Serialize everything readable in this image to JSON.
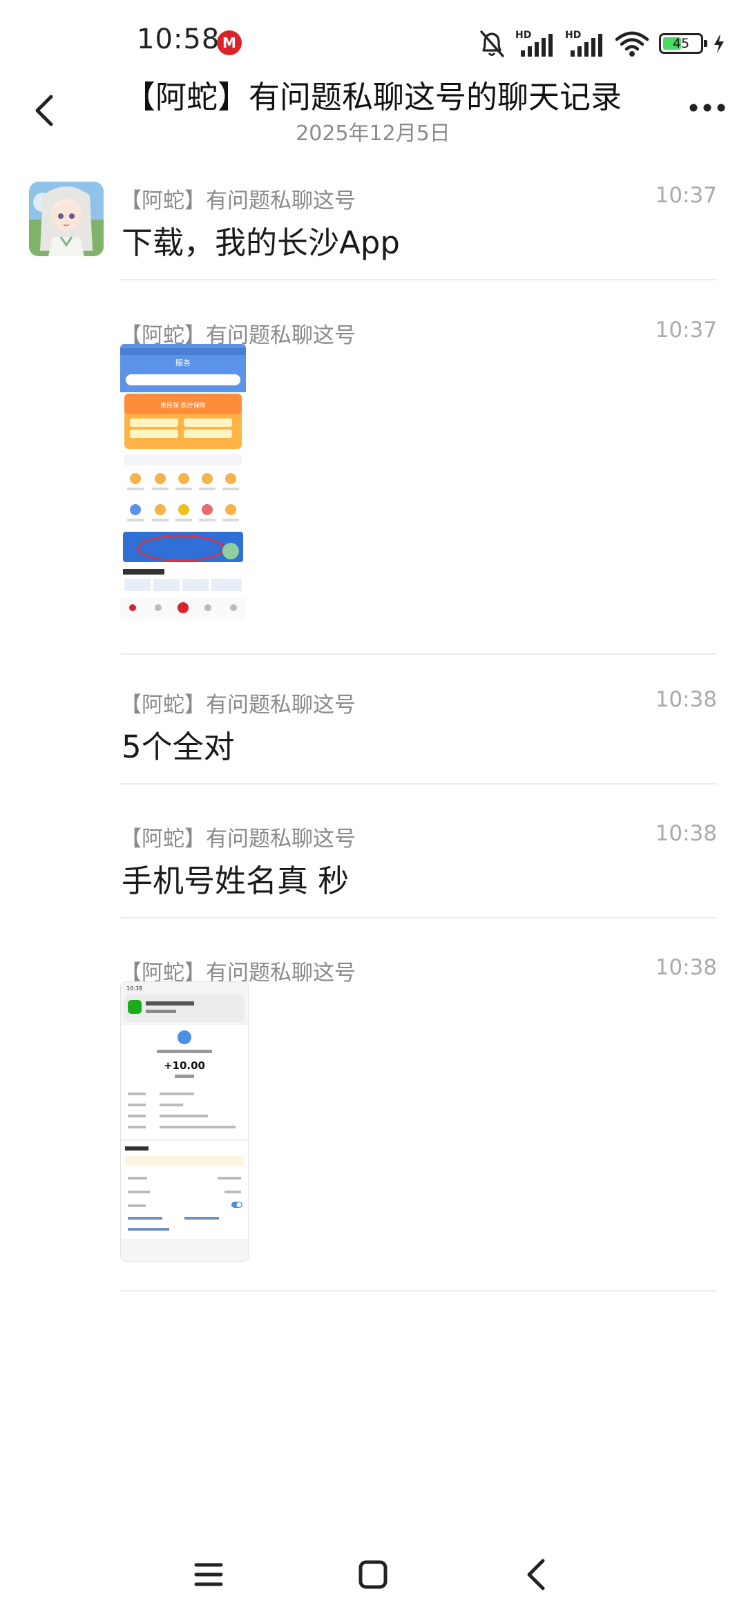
{
  "status_bar": {
    "time": "10:58",
    "battery_level": "45",
    "signal_1": "HD",
    "signal_2": "HD"
  },
  "header": {
    "title": "【阿蛇】有问题私聊这号的聊天记录",
    "date": "2025年12月5日"
  },
  "messages": [
    {
      "sender": "【阿蛇】有问题私聊这号",
      "time": "10:37",
      "text": "下载，我的长沙App"
    },
    {
      "sender": "【阿蛇】有问题私聊这号",
      "time": "10:37",
      "type": "image"
    },
    {
      "sender": "【阿蛇】有问题私聊这号",
      "time": "10:38",
      "text": "5个全对"
    },
    {
      "sender": "【阿蛇】有问题私聊这号",
      "time": "10:38",
      "text": "手机号姓名真  秒"
    },
    {
      "sender": "【阿蛇】有问题私聊这号",
      "time": "10:38",
      "type": "image"
    }
  ],
  "image_1": {
    "tab_active": "服务",
    "banner": "惠民保·医疗保障"
  },
  "image_2": {
    "time": "10:38",
    "amount": "+10.00"
  },
  "colors": {
    "accent_red": "#d8232a",
    "battery_green": "#4cd964",
    "sender_gray": "#8a8a8a"
  },
  "icons": [
    "metro-icon",
    "mute-bell-icon",
    "signal-icon",
    "wifi-icon",
    "battery-icon",
    "charging-icon",
    "back-arrow-icon",
    "more-dots-icon",
    "menu-icon",
    "home-square-icon",
    "back-triangle-icon"
  ]
}
